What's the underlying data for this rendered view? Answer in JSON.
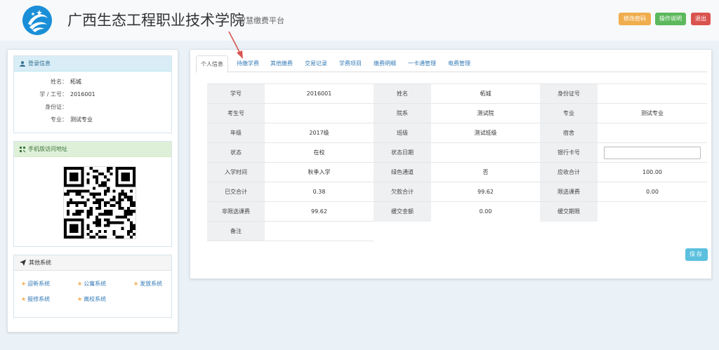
{
  "header": {
    "title": "广西生态工程职业技术学院",
    "subtitle": "智慧缴费平台",
    "buttons": {
      "change_password": "修改密码",
      "help": "操作说明",
      "exit": "退出"
    }
  },
  "login_info": {
    "title": "登录信息",
    "rows": [
      {
        "label": "姓名：",
        "value": "柘城"
      },
      {
        "label": "学 / 工号：",
        "value": "2016001"
      },
      {
        "label": "身份证：",
        "value": ""
      },
      {
        "label": "专业：",
        "value": "测试专业"
      }
    ]
  },
  "mobile": {
    "title": "手机版访问地址"
  },
  "other_systems": {
    "title": "其他系统",
    "links": [
      "迎新系统",
      "公寓系统",
      "发放系统",
      "报修系统",
      "离校系统"
    ]
  },
  "tabs": [
    "个人信息",
    "待缴学费",
    "其他缴费",
    "交易记录",
    "学费项目",
    "缴费明细",
    "一卡通管理",
    "电费管理"
  ],
  "info_table": [
    [
      {
        "label": "学号",
        "value": "2016001"
      },
      {
        "label": "姓名",
        "value": "柘城"
      },
      {
        "label": "身份证号",
        "value": ""
      }
    ],
    [
      {
        "label": "考生号",
        "value": ""
      },
      {
        "label": "院系",
        "value": "测试院"
      },
      {
        "label": "专业",
        "value": "测试专业"
      }
    ],
    [
      {
        "label": "年级",
        "value": "2017级"
      },
      {
        "label": "班级",
        "value": "测试班级"
      },
      {
        "label": "宿舍",
        "value": ""
      }
    ],
    [
      {
        "label": "状态",
        "value": "在校"
      },
      {
        "label": "状态日期",
        "value": ""
      },
      {
        "label": "银行卡号",
        "value": ""
      }
    ],
    [
      {
        "label": "入学时间",
        "value": "秋季入学"
      },
      {
        "label": "绿色通道",
        "value": "否"
      },
      {
        "label": "应收合计",
        "value": "100.00"
      }
    ],
    [
      {
        "label": "已交合计",
        "value": "0.38"
      },
      {
        "label": "欠款合计",
        "value": "99.62"
      },
      {
        "label": "限选课费",
        "value": "0.00"
      }
    ],
    [
      {
        "label": "非限选课费",
        "value": "99.62"
      },
      {
        "label": "缓交金额",
        "value": "0.00"
      },
      {
        "label": "缓交期限",
        "value": ""
      }
    ],
    [
      {
        "label": "备注",
        "value": ""
      }
    ]
  ],
  "save_label": "保存",
  "colors": {
    "info_head_bg": "#d9edf7",
    "mobile_head_bg": "#dff0d8",
    "link": "#337ab7",
    "btn_orange": "#f0ad4e",
    "btn_green": "#5cb85c",
    "btn_red": "#d9534f",
    "btn_save": "#5bc0de",
    "arrow": "#d9534f"
  }
}
